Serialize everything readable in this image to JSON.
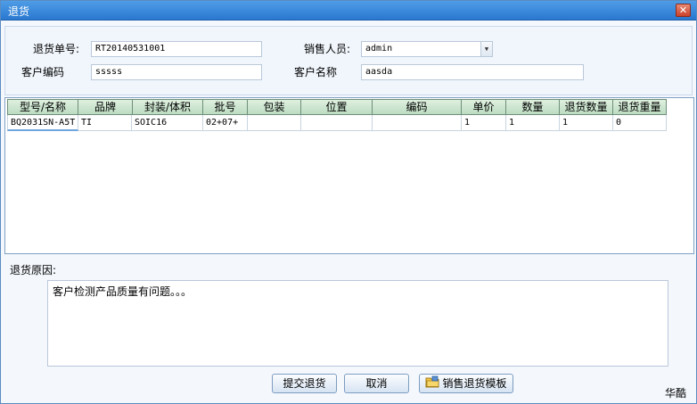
{
  "window": {
    "title": "退货",
    "close_symbol": "✕"
  },
  "form": {
    "return_no_label": "退货单号:",
    "return_no_value": "RT20140531001",
    "salesperson_label": "销售人员:",
    "salesperson_value": "admin",
    "customer_code_label": "客户编码",
    "customer_code_value": "sssss",
    "customer_name_label": "客户名称",
    "customer_name_value": "aasda"
  },
  "table": {
    "headers": [
      "型号/名称",
      "品牌",
      "封装/体积",
      "批号",
      "包装",
      "位置",
      "编码",
      "单价",
      "数量",
      "退货数量",
      "退货重量"
    ],
    "rows": [
      [
        "BQ2031SN-A5T",
        "TI",
        "SOIC16",
        "02+07+",
        "",
        "",
        "",
        "1",
        "1",
        "1",
        "0"
      ]
    ]
  },
  "reason": {
    "label": "退货原因:",
    "text": "客户检测产品质量有问题。。。"
  },
  "buttons": {
    "submit": "提交退货",
    "cancel": "取消",
    "template": "销售退货模板"
  },
  "brand": "华酷",
  "icons": {
    "close": "close-icon",
    "dropdown": "chevron-down-icon",
    "template": "folder-icon"
  },
  "colors": {
    "titlebar": "#2a78d0",
    "header": "#bcdcc2"
  }
}
